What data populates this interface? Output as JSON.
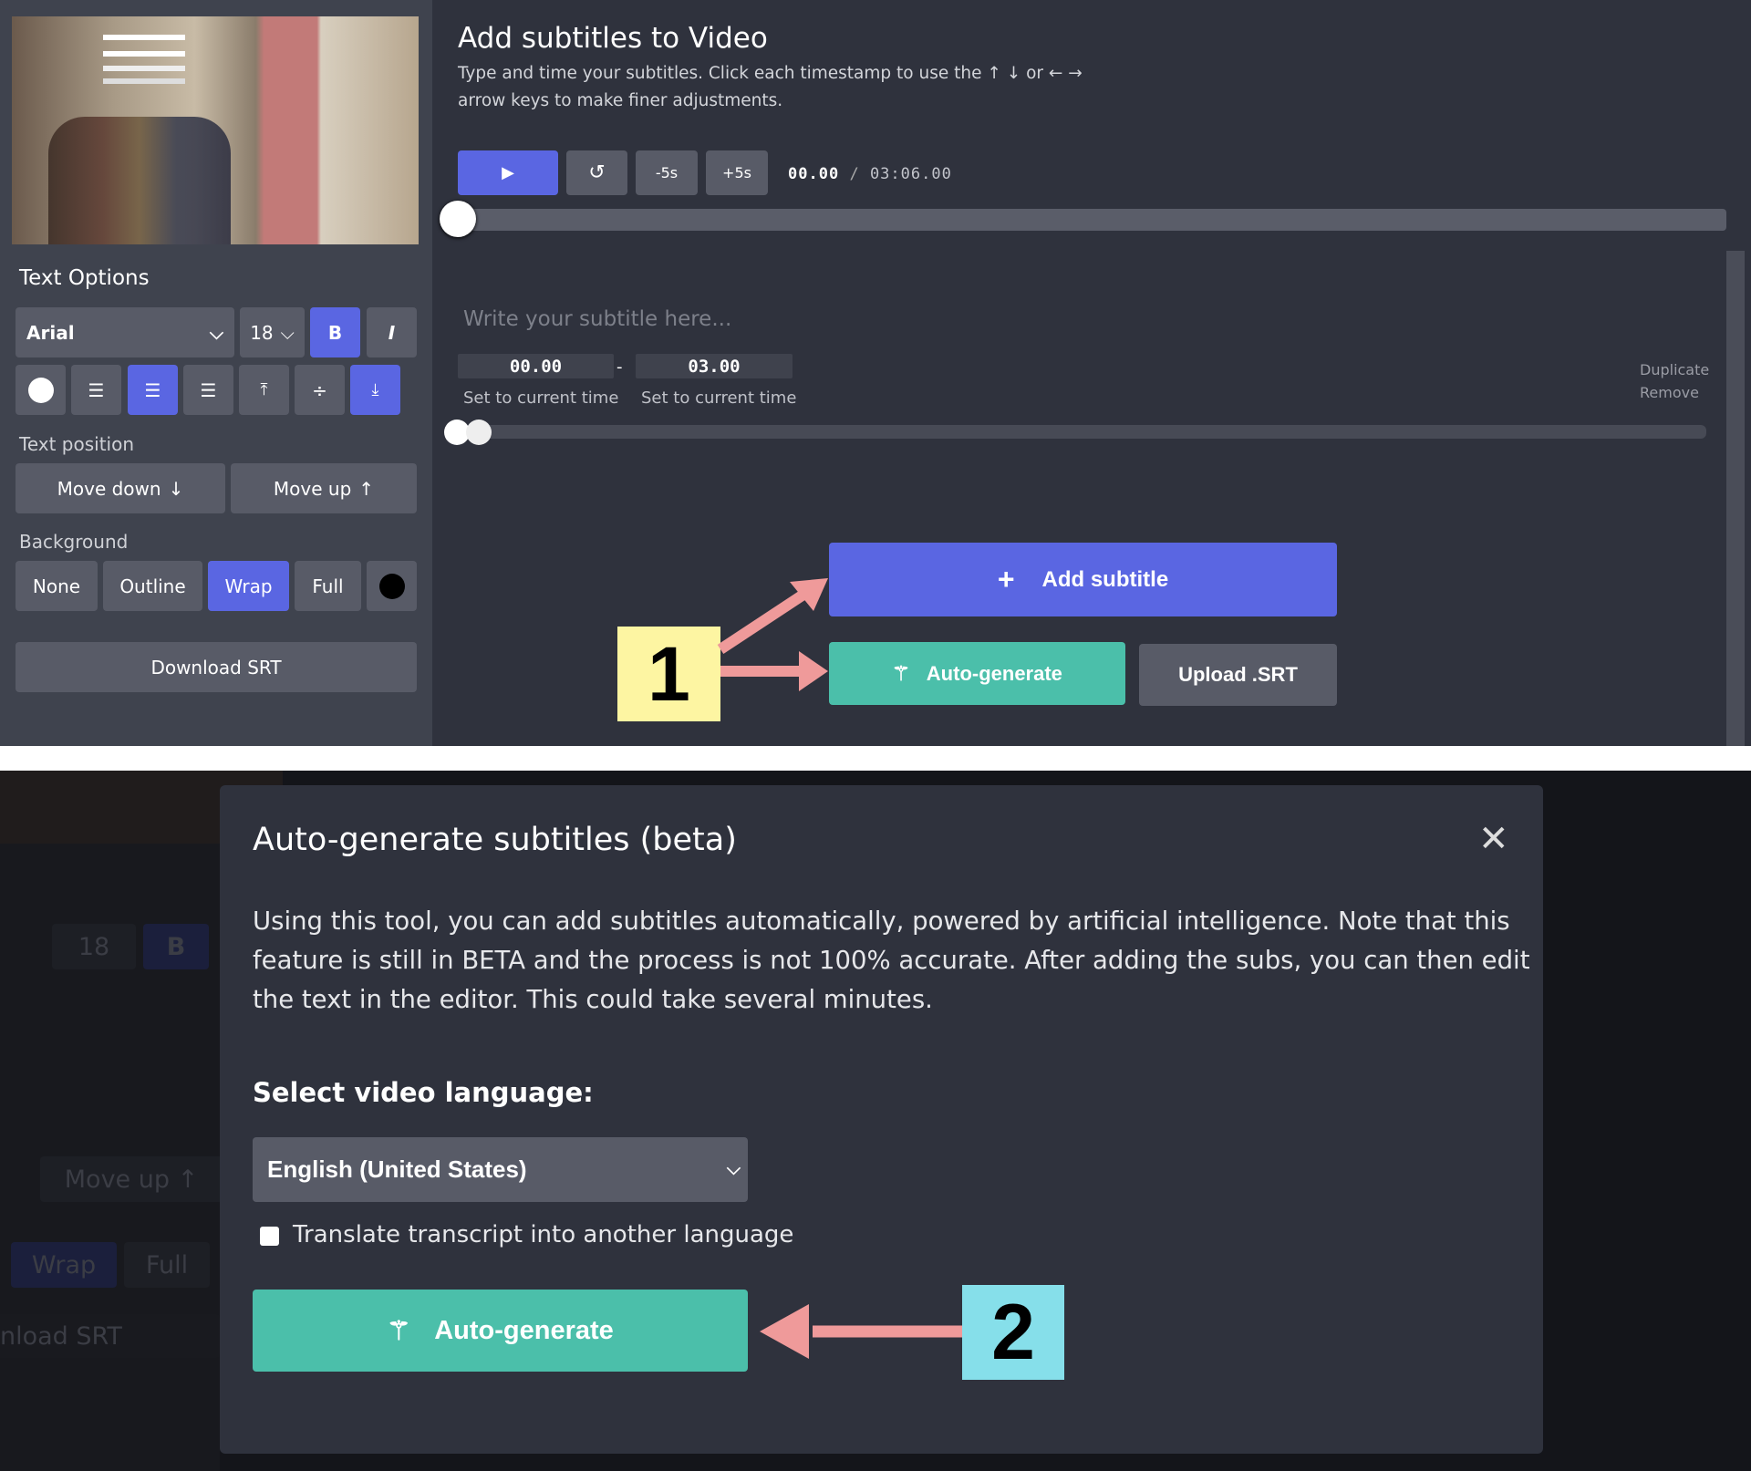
{
  "sidebar": {
    "text_options_title": "Text Options",
    "font": "Arial",
    "font_size": "18",
    "bold": "B",
    "italic": "I",
    "text_position_label": "Text position",
    "move_down": "Move down",
    "move_up": "Move up",
    "background_label": "Background",
    "bg_options": [
      "None",
      "Outline",
      "Wrap",
      "Full"
    ],
    "bg_selected": "Wrap",
    "download_srt": "Download SRT",
    "text_color": "#ffffff",
    "bg_color": "#000000"
  },
  "main": {
    "title": "Add subtitles to Video",
    "description_line1": "Type and time your subtitles. Click each timestamp to use the ↑ ↓ or ← →",
    "description_line2": "arrow keys to make finer adjustments.",
    "minus5": "-5s",
    "plus5": "+5s",
    "current_time": "00.00",
    "separator": "/",
    "duration": "03:06.00",
    "progress": 0,
    "subtitle_placeholder": "Write your subtitle here...",
    "start_time": "00.00",
    "end_time": "03.00",
    "dash": "-",
    "set_current": "Set to current time",
    "duplicate": "Duplicate",
    "remove": "Remove",
    "add_subtitle": "Add subtitle",
    "auto_generate": "Auto-generate",
    "upload_srt": "Upload .SRT"
  },
  "annotations": {
    "step1": "1",
    "step2": "2"
  },
  "modal": {
    "title": "Auto-generate subtitles (beta)",
    "body_line1": "Using this tool, you can add subtitles automatically, powered by artificial intelligence. Note that this",
    "body_line2": "feature is still in BETA and the process is not 100% accurate. After adding the subs, you can then edit",
    "body_line3": "the text in the editor. This could take several minutes.",
    "language_label": "Select video language:",
    "language": "English (United States)",
    "translate_label": "Translate transcript into another language",
    "translate_checked": false,
    "auto_generate": "Auto-generate"
  },
  "background_dim": {
    "size": "18",
    "bold": "B",
    "move_up": "Move up ↑",
    "wrap": "Wrap",
    "full": "Full",
    "download": "nload SRT"
  },
  "colors": {
    "accent": "#5a66e2",
    "teal": "#4bbfaa",
    "annotation_arrow": "#ef9a9a",
    "step1_bg": "#fdf5a2",
    "step2_bg": "#86dfea"
  }
}
